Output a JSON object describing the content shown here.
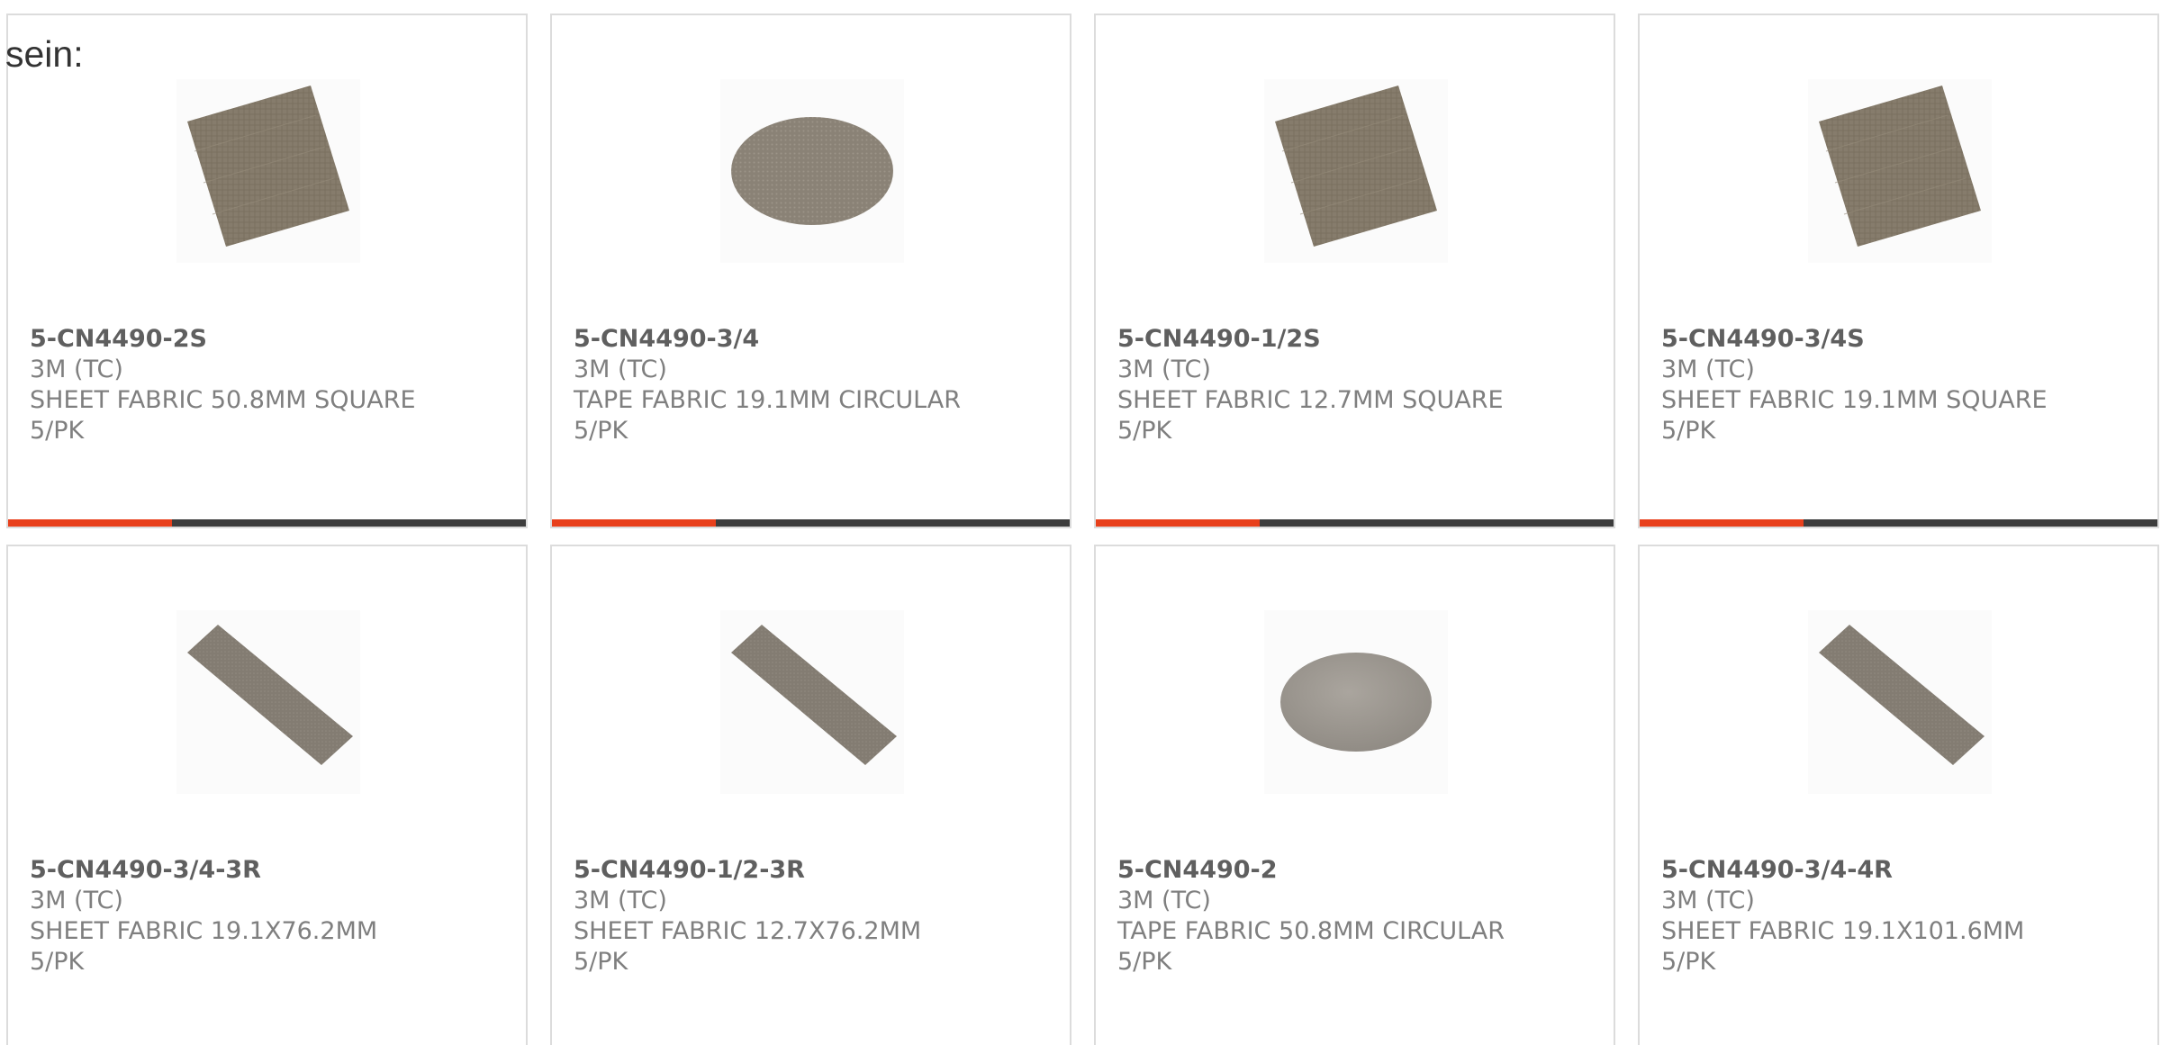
{
  "intro_text": "sein:",
  "colors": {
    "accent": "#e8401c",
    "bar": "#3d3d3d",
    "fabric": "#857b6b"
  },
  "products": [
    {
      "part": "5-CN4490-2S",
      "brand": "3M (TC)",
      "description": "SHEET FABRIC 50.8MM SQUARE",
      "pack": "5/PK",
      "shape": "square-icon"
    },
    {
      "part": "5-CN4490-3/4",
      "brand": "3M (TC)",
      "description": "TAPE FABRIC 19.1MM CIRCULAR",
      "pack": "5/PK",
      "shape": "circle-icon"
    },
    {
      "part": "5-CN4490-1/2S",
      "brand": "3M (TC)",
      "description": "SHEET FABRIC 12.7MM SQUARE",
      "pack": "5/PK",
      "shape": "square-icon"
    },
    {
      "part": "5-CN4490-3/4S",
      "brand": "3M (TC)",
      "description": "SHEET FABRIC 19.1MM SQUARE",
      "pack": "5/PK",
      "shape": "square-icon"
    },
    {
      "part": "5-CN4490-3/4-3R",
      "brand": "3M (TC)",
      "description": "SHEET FABRIC 19.1X76.2MM",
      "pack": "5/PK",
      "shape": "strip-icon"
    },
    {
      "part": "5-CN4490-1/2-3R",
      "brand": "3M (TC)",
      "description": "SHEET FABRIC 12.7X76.2MM",
      "pack": "5/PK",
      "shape": "strip-icon"
    },
    {
      "part": "5-CN4490-2",
      "brand": "3M (TC)",
      "description": "TAPE FABRIC 50.8MM CIRCULAR",
      "pack": "5/PK",
      "shape": "circle-icon"
    },
    {
      "part": "5-CN4490-3/4-4R",
      "brand": "3M (TC)",
      "description": "SHEET FABRIC 19.1X101.6MM",
      "pack": "5/PK",
      "shape": "strip-icon"
    }
  ]
}
